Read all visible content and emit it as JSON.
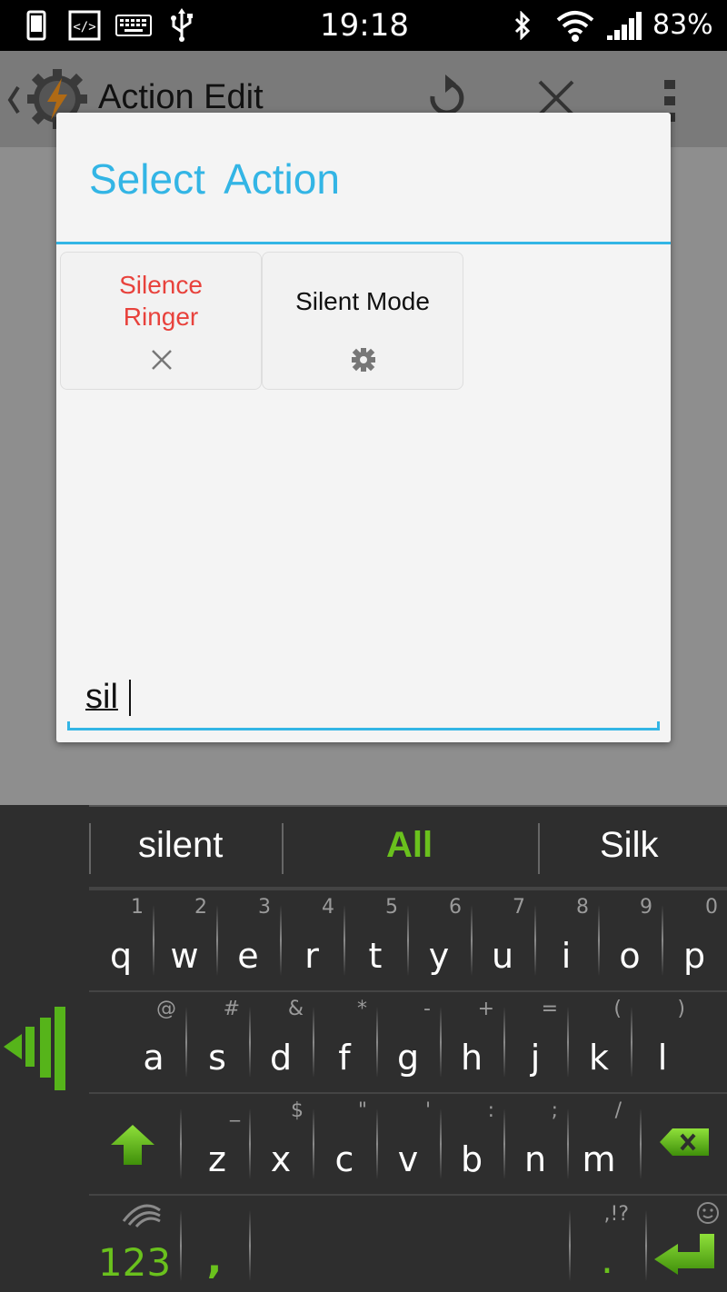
{
  "status_bar": {
    "time": "19:18",
    "battery": "83%",
    "icons": [
      "phone-icon",
      "developer-icon",
      "keyboard-icon",
      "usb-icon",
      "bluetooth-icon",
      "wifi-icon",
      "signal-icon"
    ]
  },
  "action_bar": {
    "title": "Action Edit",
    "icons": [
      "back-chevron-icon",
      "tasker-logo-icon",
      "undo-icon",
      "close-icon",
      "overflow-menu-icon"
    ]
  },
  "dialog": {
    "title": "Select  Action",
    "actions": [
      {
        "label": "Silence Ringer",
        "icon": "close-icon",
        "color": "#e8423c"
      },
      {
        "label": "Silent Mode",
        "icon": "gear-icon",
        "color": "#111111"
      }
    ],
    "filter_value": "sil"
  },
  "keyboard": {
    "predictions": [
      "silent",
      "All",
      "Silk"
    ],
    "highlight": "All",
    "row1": [
      {
        "main": "q",
        "sub": "1"
      },
      {
        "main": "w",
        "sub": "2"
      },
      {
        "main": "e",
        "sub": "3"
      },
      {
        "main": "r",
        "sub": "4"
      },
      {
        "main": "t",
        "sub": "5"
      },
      {
        "main": "y",
        "sub": "6"
      },
      {
        "main": "u",
        "sub": "7"
      },
      {
        "main": "i",
        "sub": "8"
      },
      {
        "main": "o",
        "sub": "9"
      },
      {
        "main": "p",
        "sub": "0"
      }
    ],
    "row2": [
      {
        "main": "a",
        "sub": "@"
      },
      {
        "main": "s",
        "sub": "#"
      },
      {
        "main": "d",
        "sub": "&"
      },
      {
        "main": "f",
        "sub": "*"
      },
      {
        "main": "g",
        "sub": "-"
      },
      {
        "main": "h",
        "sub": "+"
      },
      {
        "main": "j",
        "sub": "="
      },
      {
        "main": "k",
        "sub": "("
      },
      {
        "main": "l",
        "sub": ")"
      }
    ],
    "row3": [
      {
        "main": "z",
        "sub": "_"
      },
      {
        "main": "x",
        "sub": "$"
      },
      {
        "main": "c",
        "sub": "\""
      },
      {
        "main": "v",
        "sub": "'"
      },
      {
        "main": "b",
        "sub": ":"
      },
      {
        "main": "n",
        "sub": ";"
      },
      {
        "main": "m",
        "sub": "/"
      }
    ],
    "row4": {
      "symbols": "123",
      "comma": ",",
      "period": ".",
      "period_sub": ",!?"
    },
    "accent_color": "#6ac11d"
  }
}
